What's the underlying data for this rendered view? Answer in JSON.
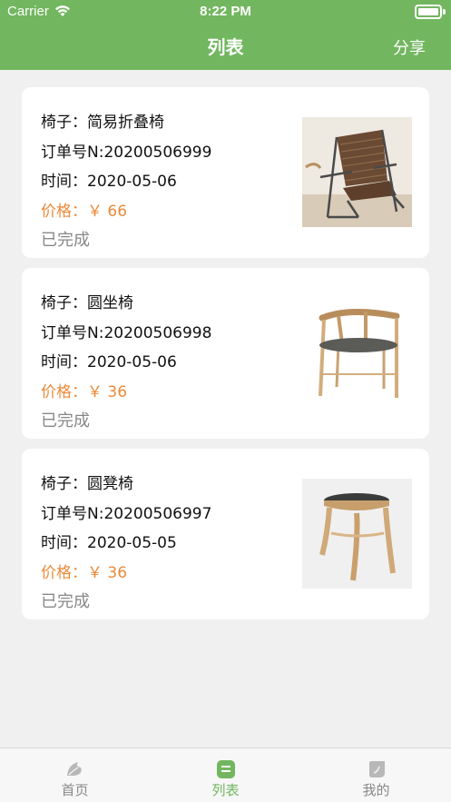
{
  "status_bar": {
    "carrier": "Carrier",
    "time": "8:22 PM"
  },
  "nav": {
    "title": "列表",
    "share_label": "分享"
  },
  "orders": [
    {
      "chair": "椅子：简易折叠椅",
      "order_no": "订单号N:20200506999",
      "time": "时间：2020-05-06",
      "price_label": "价格：",
      "price": "￥ 66",
      "status": "已完成",
      "image": "folding-chair"
    },
    {
      "chair": "椅子：圆坐椅",
      "order_no": "订单号N:20200506998",
      "time": "时间：2020-05-06",
      "price_label": "价格：",
      "price": "￥ 36",
      "status": "已完成",
      "image": "round-armchair"
    },
    {
      "chair": "椅子：圆凳椅",
      "order_no": "订单号N:20200506997",
      "time": "时间：2020-05-05",
      "price_label": "价格：",
      "price": "￥ 36",
      "status": "已完成",
      "image": "round-stool"
    }
  ],
  "tabbar": {
    "items": [
      {
        "label": "首页",
        "icon": "leaf-icon",
        "active": false
      },
      {
        "label": "列表",
        "icon": "list-icon",
        "active": true
      },
      {
        "label": "我的",
        "icon": "profile-icon",
        "active": false
      }
    ]
  },
  "colors": {
    "primary": "#72b65f",
    "price": "#ec8a3a",
    "status": "#888888",
    "background": "#f0f0f0"
  }
}
